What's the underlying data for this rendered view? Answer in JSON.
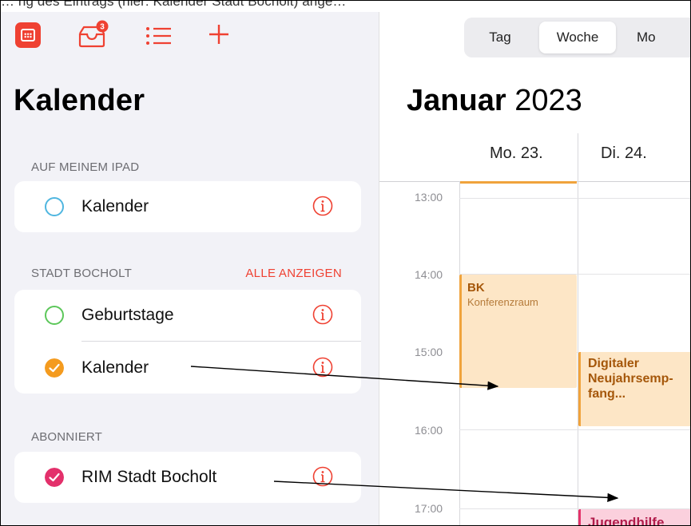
{
  "top_cropped_text": "… ng des Eintrags (hier: Kalender Stadt Bocholt) ange…",
  "sidebar": {
    "title": "Kalender",
    "inbox_badge": "3",
    "sections": [
      {
        "header": "AUF MEINEM IPAD",
        "items": [
          {
            "label": "Kalender",
            "color": "#4fb6e0",
            "checked": false
          }
        ]
      },
      {
        "header": "STADT BOCHOLT",
        "action": "ALLE ANZEIGEN",
        "items": [
          {
            "label": "Geburtstage",
            "color": "#5cc75a",
            "checked": false
          },
          {
            "label": "Kalender",
            "color": "#f49b1f",
            "checked": true
          }
        ]
      },
      {
        "header": "ABONNIERT",
        "items": [
          {
            "label": "RIM Stadt Bocholt",
            "color": "#e3306b",
            "checked": true
          }
        ]
      }
    ]
  },
  "main": {
    "view_tabs": [
      "Tag",
      "Woche",
      "Mo"
    ],
    "selected_tab": "Woche",
    "month_bold": "Januar",
    "year": "2023",
    "days": [
      "Mo. 23.",
      "Di. 24."
    ],
    "hours": [
      "13:00",
      "14:00",
      "15:00",
      "16:00",
      "17:00"
    ],
    "events": [
      {
        "title": "BK",
        "subtitle": "Konferenzraum",
        "day": "Mo. 23.",
        "start": "14:00",
        "end": "15:30"
      },
      {
        "title": "Digitaler Neujahrsemp-fang...",
        "title_lines": [
          "Digitaler",
          "Neujahrsemp-",
          "fang..."
        ],
        "day": "Di. 24.",
        "start": "15:00",
        "end": "16:00"
      },
      {
        "title": "Jugendhilfe",
        "day": "Di. 24.",
        "start": "17:00"
      }
    ]
  },
  "colors": {
    "accent": "#ef4132",
    "orange_event_bg": "#fde6c6",
    "pink_event_bg": "#fbd0dd"
  }
}
